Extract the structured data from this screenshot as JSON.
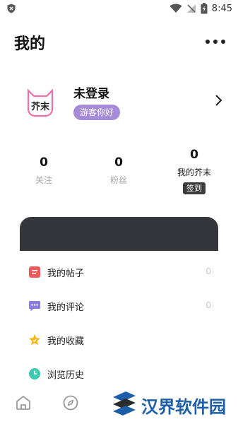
{
  "status_bar": {
    "time": "8:45"
  },
  "header": {
    "title": "我的"
  },
  "profile": {
    "avatar_text": "芥末",
    "username": "未登录",
    "badge": "游客你好"
  },
  "stats": [
    {
      "value": "0",
      "label": "关注"
    },
    {
      "value": "0",
      "label": "粉丝"
    },
    {
      "value": "0",
      "label": "我的芥末",
      "action": "签到"
    }
  ],
  "menu": [
    {
      "label": "我的帖子",
      "count": "0",
      "icon": "post-icon",
      "color": "#f05a5a"
    },
    {
      "label": "我的评论",
      "count": "0",
      "icon": "comment-icon",
      "color": "#8b7be0"
    },
    {
      "label": "我的收藏",
      "count": "",
      "icon": "star-icon",
      "color": "#f6b71a"
    },
    {
      "label": "浏览历史",
      "count": "",
      "icon": "clock-icon",
      "color": "#3ec9b0"
    }
  ],
  "bottom_nav": {
    "icons": [
      "home-icon",
      "compass-icon"
    ]
  },
  "watermark": {
    "text": "汉界软件园"
  },
  "colors": {
    "accent": "#a68bd9",
    "card": "#34363b",
    "watermark": "#1c5fa8"
  }
}
